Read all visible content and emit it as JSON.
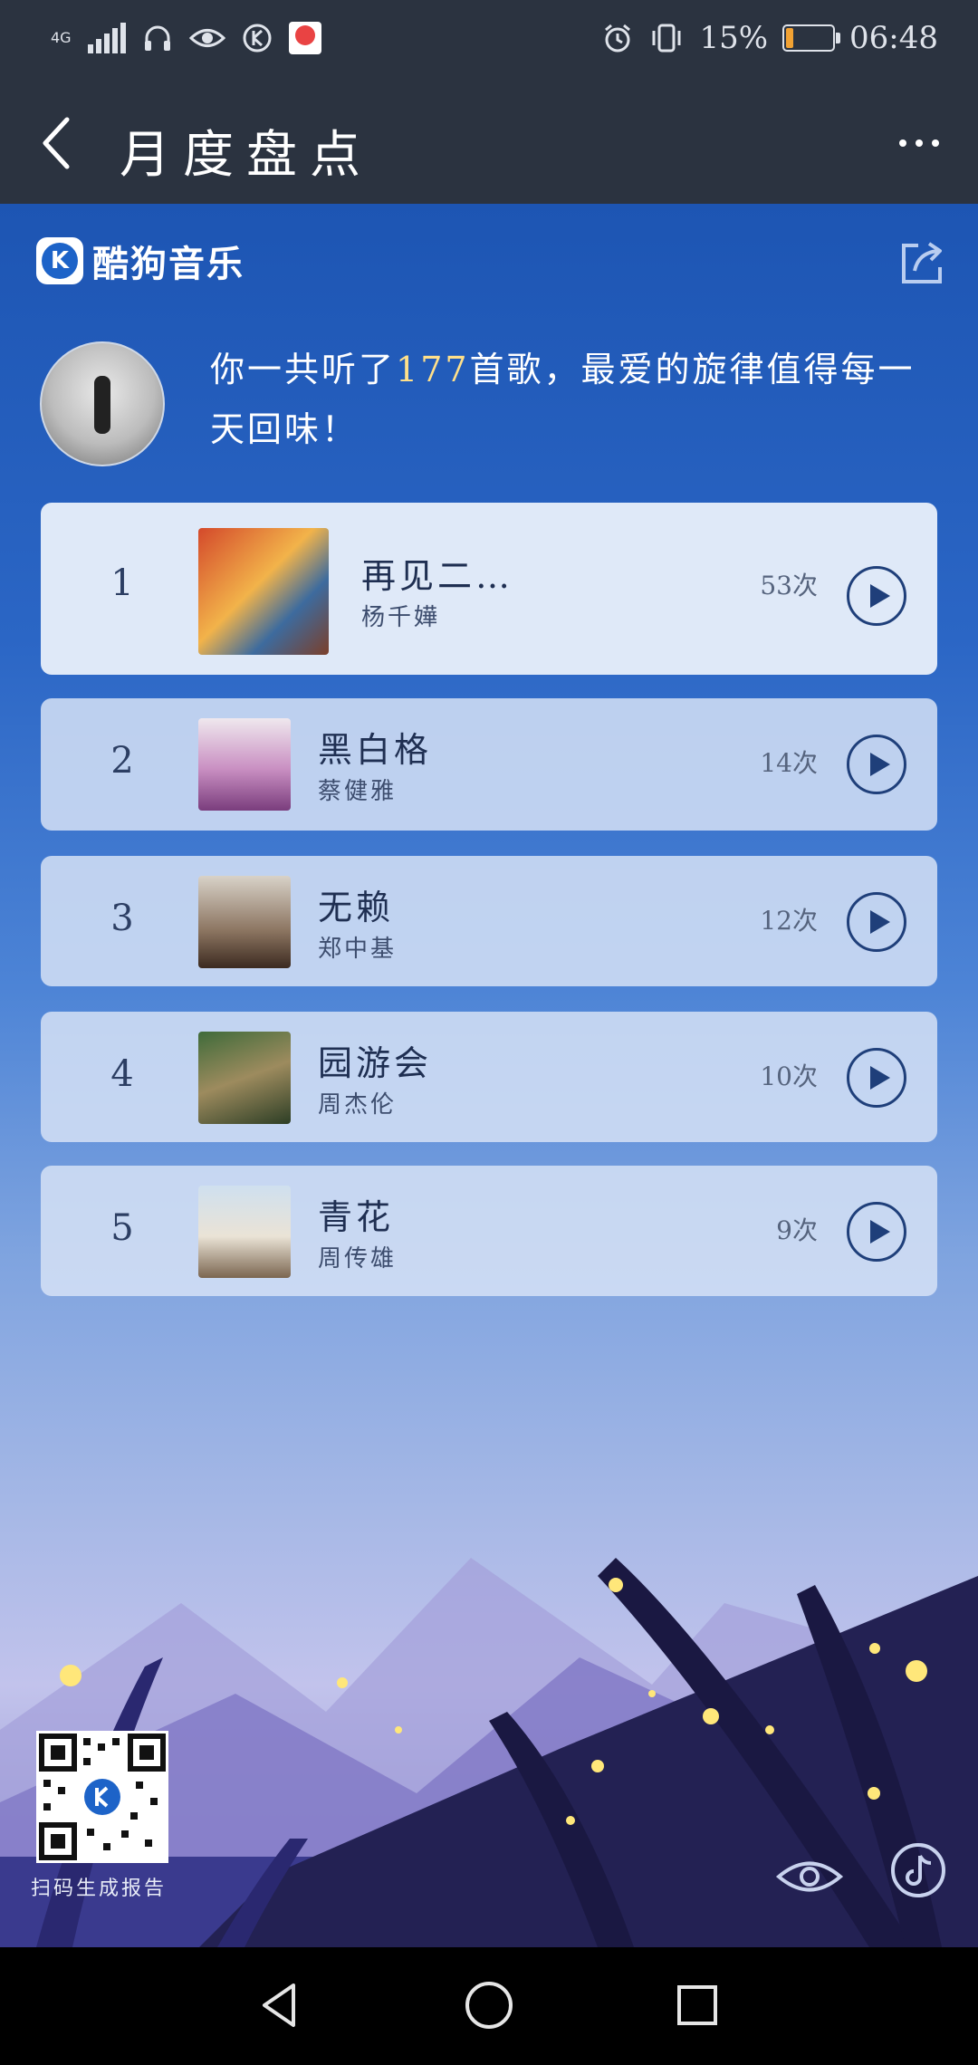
{
  "status_bar": {
    "network_type": "4G",
    "battery_percent_text": "15%",
    "battery_level": 0.15,
    "time": "06:48",
    "icons": [
      "signal-icon",
      "headphones-icon",
      "eye-icon",
      "kugou-k-icon",
      "app-badge-icon",
      "alarm-icon",
      "vibrate-icon",
      "battery-icon"
    ]
  },
  "header": {
    "title": "月度盘点",
    "back_icon": "back-chevron-icon",
    "more_icon": "more-dots-icon"
  },
  "report": {
    "brand_logo_letter": "K",
    "brand_name": "酷狗音乐",
    "share_icon": "share-icon",
    "summary_prefix": "你一共听了",
    "summary_count": "177",
    "summary_suffix": "首歌，最爱的旋律值得每一天回味！",
    "songs": [
      {
        "rank": "1",
        "title": "再见二…",
        "artist": "杨千嬅",
        "plays": "53次"
      },
      {
        "rank": "2",
        "title": "黑白格",
        "artist": "蔡健雅",
        "plays": "14次"
      },
      {
        "rank": "3",
        "title": "无赖",
        "artist": "郑中基",
        "plays": "12次"
      },
      {
        "rank": "4",
        "title": "园游会",
        "artist": "周杰伦",
        "plays": "10次"
      },
      {
        "rank": "5",
        "title": "青花",
        "artist": "周传雄",
        "plays": "9次"
      }
    ],
    "qr_label": "扫码生成报告"
  },
  "nav_bar": {
    "icons": [
      "back-triangle-icon",
      "home-circle-icon",
      "recents-square-icon"
    ]
  },
  "colors": {
    "header_bg": "#2b3340",
    "report_top": "#1d55b3",
    "highlight": "#ffe08a",
    "card_bg": "#e7eefa",
    "accent_dark": "#1f3f7a"
  }
}
